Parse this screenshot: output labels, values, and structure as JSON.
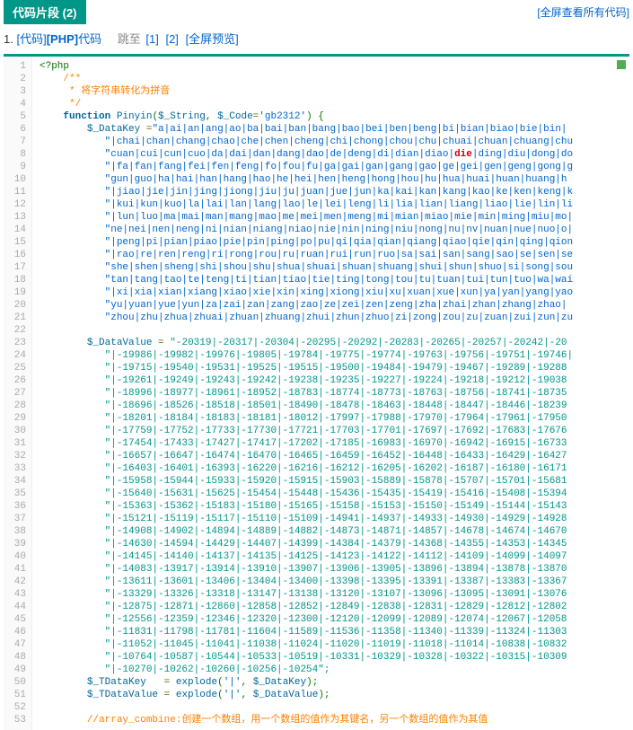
{
  "header": {
    "tab_label": "代码片段 (2)",
    "view_all": "[全屏查看所有代码]"
  },
  "subhead": {
    "index": "1.",
    "link1": "[代码]",
    "link2": "[PHP]",
    "link3": "代码",
    "jump_label": "跳至",
    "jump1": "[1]",
    "jump2": "[2]",
    "jump3": "[全屏预览]"
  },
  "code": {
    "lines": [
      [
        [
          "default",
          "<?php"
        ]
      ],
      [
        [
          "default",
          "    "
        ],
        [
          "comment",
          "/**"
        ]
      ],
      [
        [
          "default",
          "     "
        ],
        [
          "comment",
          "* 将字符串转化为拼音"
        ]
      ],
      [
        [
          "default",
          "     "
        ],
        [
          "comment",
          "*/"
        ]
      ],
      [
        [
          "default",
          "    "
        ],
        [
          "keyword",
          "function"
        ],
        [
          "default",
          " "
        ],
        [
          "func",
          "Pinyin"
        ],
        [
          "default",
          "("
        ],
        [
          "var",
          "$_String"
        ],
        [
          "default",
          ", "
        ],
        [
          "var",
          "$_Code"
        ],
        [
          "op",
          "="
        ],
        [
          "str",
          "'gb2312'"
        ],
        [
          "default",
          ") {"
        ]
      ],
      [
        [
          "default",
          "        "
        ],
        [
          "var",
          "$_DataKey"
        ],
        [
          "default",
          " "
        ],
        [
          "op",
          "="
        ],
        [
          "str",
          "\"a|ai|an|ang|ao|ba|bai|ban|bang|bao|bei|ben|beng|bi|bian|biao|bie|bin|"
        ]
      ],
      [
        [
          "str",
          "           \"|chai|chan|chang|chao|che|chen|cheng|chi|chong|chou|chu|chuai|chuan|chuang|chu"
        ]
      ],
      [
        [
          "str",
          "           \"cuan|cui|cun|cuo|da|dai|dan|dang|dao|de|deng|di|dian|diao|"
        ],
        [
          "die",
          "die"
        ],
        [
          "str",
          "|ding|diu|dong|do"
        ]
      ],
      [
        [
          "str",
          "           \"|fa|fan|fang|fei|fen|feng|fo|fou|fu|ga|gai|gan|gang|gao|ge|gei|gen|geng|gong|g"
        ]
      ],
      [
        [
          "str",
          "           \"gun|guo|ha|hai|han|hang|hao|he|hei|hen|heng|hong|hou|hu|hua|huai|huan|huang|h"
        ]
      ],
      [
        [
          "str",
          "           \"|jiao|jie|jin|jing|jiong|jiu|ju|juan|jue|jun|ka|kai|kan|kang|kao|ke|ken|keng|k"
        ]
      ],
      [
        [
          "str",
          "           \"|kui|kun|kuo|la|lai|lan|lang|lao|le|lei|leng|li|lia|lian|liang|liao|lie|lin|li"
        ]
      ],
      [
        [
          "str",
          "           \"|lun|luo|ma|mai|man|mang|mao|me|mei|men|meng|mi|mian|miao|mie|min|ming|miu|mo|"
        ]
      ],
      [
        [
          "str",
          "           \"ne|nei|nen|neng|ni|nian|niang|niao|nie|nin|ning|niu|nong|nu|nv|nuan|nue|nuo|o|"
        ]
      ],
      [
        [
          "str",
          "           \"|peng|pi|pian|piao|pie|pin|ping|po|pu|qi|qia|qian|qiang|qiao|qie|qin|qing|qion"
        ]
      ],
      [
        [
          "str",
          "           \"|rao|re|ren|reng|ri|rong|rou|ru|ruan|rui|run|ruo|sa|sai|san|sang|sao|se|sen|se"
        ]
      ],
      [
        [
          "str",
          "           \"she|shen|sheng|shi|shou|shu|shua|shuai|shuan|shuang|shui|shun|shuo|si|song|sou"
        ]
      ],
      [
        [
          "str",
          "           \"tan|tang|tao|te|teng|ti|tian|tiao|tie|ting|tong|tou|tu|tuan|tui|tun|tuo|wa|wai"
        ]
      ],
      [
        [
          "str",
          "           \"|xi|xia|xian|xiang|xiao|xie|xin|xing|xiong|xiu|xu|xuan|xue|xun|ya|yan|yang|yao"
        ]
      ],
      [
        [
          "str",
          "           \"yu|yuan|yue|yun|za|zai|zan|zang|zao|ze|zei|zen|zeng|zha|zhai|zhan|zhang|zhao|"
        ]
      ],
      [
        [
          "str",
          "           \"zhou|zhu|zhua|zhuai|zhuan|zhuang|zhui|zhun|zhuo|zi|zong|zou|zu|zuan|zui|zun|zu"
        ]
      ],
      [
        [
          "default",
          " "
        ]
      ],
      [
        [
          "default",
          "        "
        ],
        [
          "var",
          "$_DataValue"
        ],
        [
          "default",
          " "
        ],
        [
          "op",
          "="
        ],
        [
          "default",
          " "
        ],
        [
          "str2",
          "\"-20319|-20317|-20304|-20295|-20292|-20283|-20265|-20257|-20242|-20"
        ]
      ],
      [
        [
          "str2",
          "           \"|-19986|-19982|-19976|-19805|-19784|-19775|-19774|-19763|-19756|-19751|-19746|"
        ]
      ],
      [
        [
          "str2",
          "           \"|-19715|-19540|-19531|-19525|-19515|-19500|-19484|-19479|-19467|-19289|-19288"
        ]
      ],
      [
        [
          "str2",
          "           \"|-19261|-19249|-19243|-19242|-19238|-19235|-19227|-19224|-19218|-19212|-19038"
        ]
      ],
      [
        [
          "str2",
          "           \"|-18996|-18977|-18961|-18952|-18783|-18774|-18773|-18763|-18756|-18741|-18735"
        ]
      ],
      [
        [
          "str2",
          "           \"|-18696|-18526|-18518|-18501|-18490|-18478|-18463|-18448|-18447|-18446|-18239"
        ]
      ],
      [
        [
          "str2",
          "           \"|-18201|-18184|-18183|-18181|-18012|-17997|-17988|-17970|-17964|-17961|-17950"
        ]
      ],
      [
        [
          "str2",
          "           \"|-17759|-17752|-17733|-17730|-17721|-17703|-17701|-17697|-17692|-17683|-17676"
        ]
      ],
      [
        [
          "str2",
          "           \"|-17454|-17433|-17427|-17417|-17202|-17185|-16983|-16970|-16942|-16915|-16733"
        ]
      ],
      [
        [
          "str2",
          "           \"|-16657|-16647|-16474|-16470|-16465|-16459|-16452|-16448|-16433|-16429|-16427"
        ]
      ],
      [
        [
          "str2",
          "           \"|-16403|-16401|-16393|-16220|-16216|-16212|-16205|-16202|-16187|-16180|-16171"
        ]
      ],
      [
        [
          "str2",
          "           \"|-15958|-15944|-15933|-15920|-15915|-15903|-15889|-15878|-15707|-15701|-15681"
        ]
      ],
      [
        [
          "str2",
          "           \"|-15640|-15631|-15625|-15454|-15448|-15436|-15435|-15419|-15416|-15408|-15394"
        ]
      ],
      [
        [
          "str2",
          "           \"|-15363|-15362|-15183|-15180|-15165|-15158|-15153|-15150|-15149|-15144|-15143"
        ]
      ],
      [
        [
          "str2",
          "           \"|-15121|-15119|-15117|-15110|-15109|-14941|-14937|-14933|-14930|-14929|-14928"
        ]
      ],
      [
        [
          "str2",
          "           \"|-14908|-14902|-14894|-14889|-14882|-14873|-14871|-14857|-14678|-14674|-14670"
        ]
      ],
      [
        [
          "str2",
          "           \"|-14630|-14594|-14429|-14407|-14399|-14384|-14379|-14368|-14355|-14353|-14345"
        ]
      ],
      [
        [
          "str2",
          "           \"|-14145|-14140|-14137|-14135|-14125|-14123|-14122|-14112|-14109|-14099|-14097"
        ]
      ],
      [
        [
          "str2",
          "           \"|-14083|-13917|-13914|-13910|-13907|-13906|-13905|-13896|-13894|-13878|-13870"
        ]
      ],
      [
        [
          "str2",
          "           \"|-13611|-13601|-13406|-13404|-13400|-13398|-13395|-13391|-13387|-13383|-13367"
        ]
      ],
      [
        [
          "str2",
          "           \"|-13329|-13326|-13318|-13147|-13138|-13120|-13107|-13096|-13095|-13091|-13076"
        ]
      ],
      [
        [
          "str2",
          "           \"|-12875|-12871|-12860|-12858|-12852|-12849|-12838|-12831|-12829|-12812|-12802"
        ]
      ],
      [
        [
          "str2",
          "           \"|-12556|-12359|-12346|-12320|-12300|-12120|-12099|-12089|-12074|-12067|-12058"
        ]
      ],
      [
        [
          "str2",
          "           \"|-11831|-11798|-11781|-11604|-11589|-11536|-11358|-11340|-11339|-11324|-11303"
        ]
      ],
      [
        [
          "str2",
          "           \"|-11052|-11045|-11041|-11038|-11024|-11020|-11019|-11018|-11014|-10838|-10832"
        ]
      ],
      [
        [
          "str2",
          "           \"|-10764|-10587|-10544|-10533|-10519|-10331|-10329|-10328|-10322|-10315|-10309"
        ]
      ],
      [
        [
          "str2",
          "           \"|-10270|-10262|-10260|-10256|-10254\";"
        ]
      ],
      [
        [
          "default",
          "        "
        ],
        [
          "var",
          "$_TDataKey"
        ],
        [
          "default",
          "   "
        ],
        [
          "op",
          "="
        ],
        [
          "default",
          " "
        ],
        [
          "func",
          "explode"
        ],
        [
          "default",
          "("
        ],
        [
          "str",
          "'|'"
        ],
        [
          "default",
          ", "
        ],
        [
          "var",
          "$_DataKey"
        ],
        [
          "default",
          ");"
        ]
      ],
      [
        [
          "default",
          "        "
        ],
        [
          "var",
          "$_TDataValue"
        ],
        [
          "default",
          " "
        ],
        [
          "op",
          "="
        ],
        [
          "default",
          " "
        ],
        [
          "func",
          "explode"
        ],
        [
          "default",
          "("
        ],
        [
          "str",
          "'|'"
        ],
        [
          "default",
          ", "
        ],
        [
          "var",
          "$_DataValue"
        ],
        [
          "default",
          ");"
        ]
      ],
      [
        [
          "default",
          " "
        ]
      ],
      [
        [
          "default",
          "        "
        ],
        [
          "comment",
          "//array_combine:创建一个数组，用一个数组的值作为其键名，另一个数组的值作为其值"
        ]
      ]
    ]
  }
}
